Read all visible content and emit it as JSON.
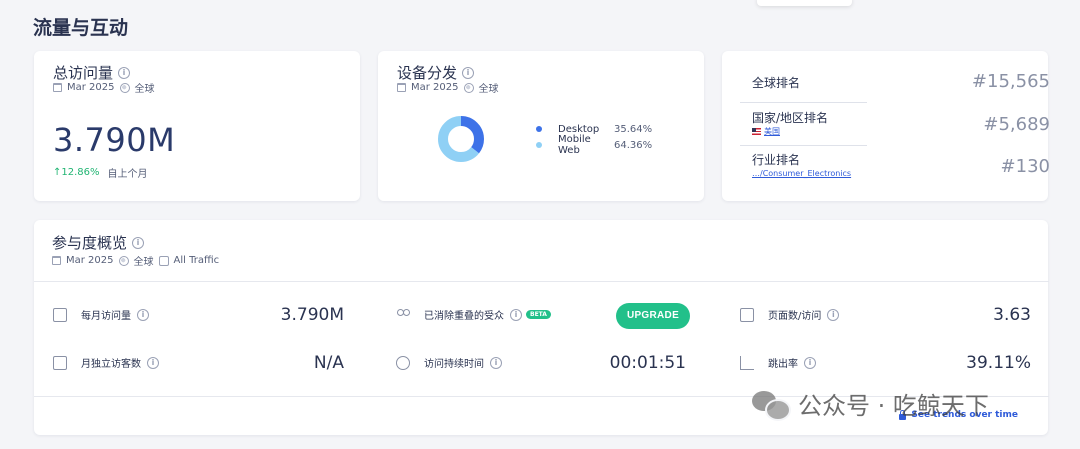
{
  "section": {
    "title": "流量与互动"
  },
  "visits_card": {
    "title": "总访问量",
    "date": "Mar 2025",
    "region": "全球",
    "value": "3.790M",
    "change": "↑12.86%",
    "comparison": "自上个月"
  },
  "device_card": {
    "title": "设备分发",
    "date": "Mar 2025",
    "region": "全球",
    "legend": [
      {
        "name": "Desktop",
        "pct": "35.64%",
        "value": 35.64,
        "color": "#3d72e8"
      },
      {
        "name": "Mobile Web",
        "pct": "64.36%",
        "value": 64.36,
        "color": "#8fd0f5"
      }
    ]
  },
  "rank_card": {
    "global_label": "全球排名",
    "global_value": "#15,565",
    "country_label": "国家/地区排名",
    "country_name": "美国",
    "country_value": "#5,689",
    "industry_label": "行业排名",
    "industry_path": "…/Consumer_Electronics",
    "industry_value": "#130"
  },
  "engagement": {
    "title": "参与度概览",
    "date": "Mar 2025",
    "region": "全球",
    "traffic": "All Traffic",
    "metrics": {
      "monthly_visits_label": "每月访问量",
      "monthly_visits_value": "3.790M",
      "dedup_label": "已消除重叠的受众",
      "beta": "BETA",
      "upgrade": "UPGRADE",
      "pages_label": "页面数/访问",
      "pages_value": "3.63",
      "unique_label": "月独立访客数",
      "unique_value": "N/A",
      "duration_label": "访问持续时间",
      "duration_value": "00:01:51",
      "bounce_label": "跳出率",
      "bounce_value": "39.11%"
    },
    "trends_link": "See trends over time"
  },
  "watermark": {
    "text": "公众号 · 吃鲸天下"
  }
}
